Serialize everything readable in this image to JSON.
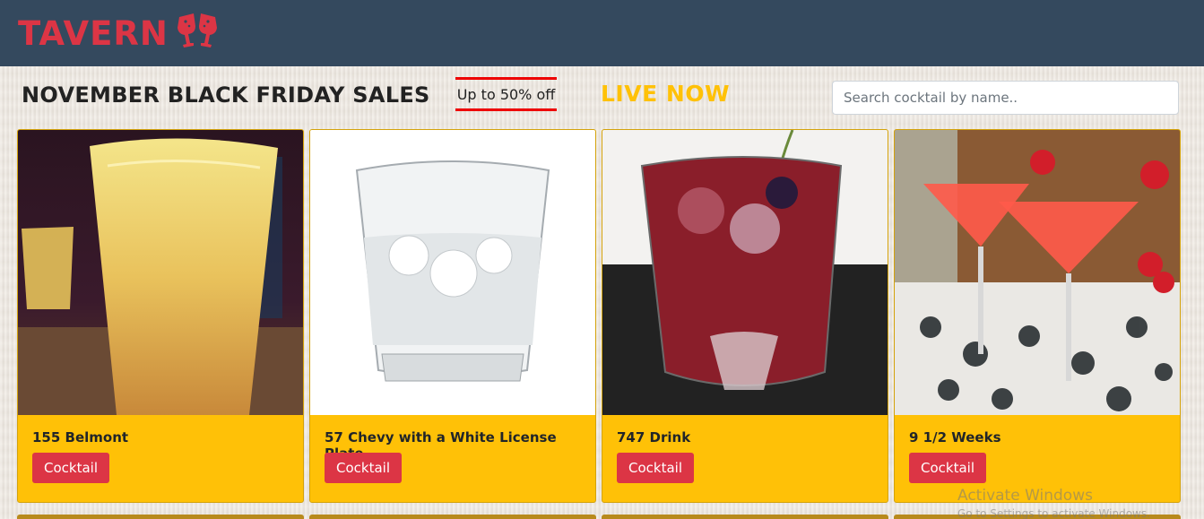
{
  "navbar": {
    "brand": "TAVERN",
    "brand_icon": "cheers-glasses-icon",
    "bg_color": "#34495e",
    "brand_color": "#dc3545"
  },
  "promo": {
    "title": "NOVEMBER BLACK FRIDAY SALES",
    "offer": "Up to 50% off",
    "live": "LIVE NOW"
  },
  "search": {
    "placeholder": "Search cocktail by name.."
  },
  "cards": [
    {
      "name": "155 Belmont",
      "category": "Cocktail",
      "image": "orange-drink-photo"
    },
    {
      "name": "57 Chevy with a White License Plate",
      "category": "Cocktail",
      "image": "clear-glass-ice-photo"
    },
    {
      "name": "747 Drink",
      "category": "Cocktail",
      "image": "red-drink-ice-photo"
    },
    {
      "name": "9 1/2 Weeks",
      "category": "Cocktail",
      "image": "pink-martini-strawberry-photo"
    }
  ],
  "watermark": {
    "title": "Activate Windows",
    "subtitle": "Go to Settings to activate Windows."
  },
  "colors": {
    "accent": "#ffc107",
    "danger": "#dc3545"
  }
}
